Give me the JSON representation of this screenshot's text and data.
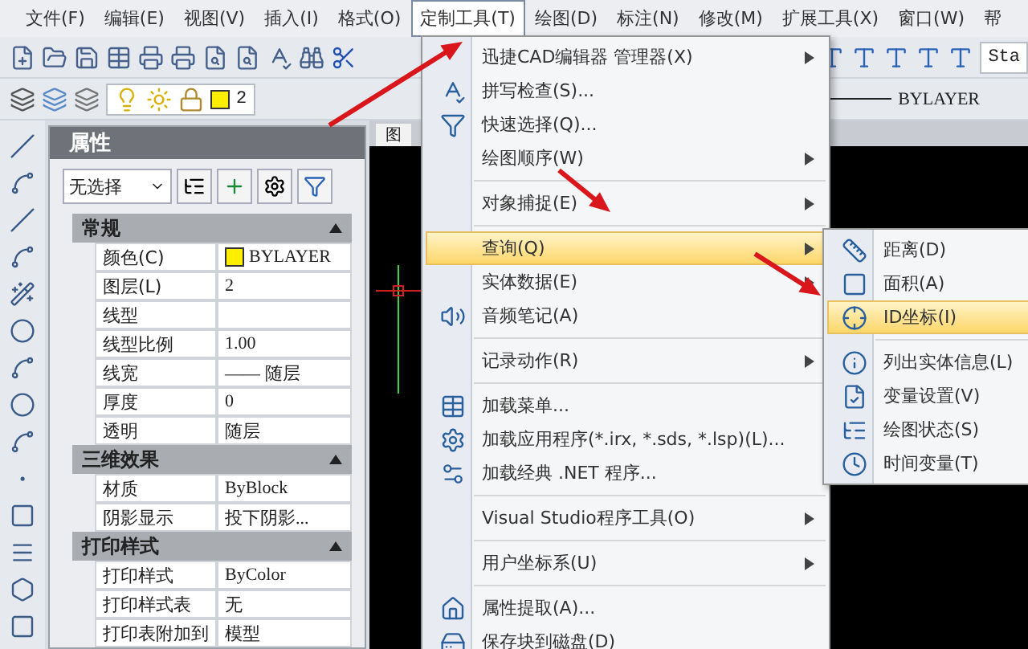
{
  "menubar": [
    {
      "label": "文件(F)",
      "selected": false
    },
    {
      "label": "编辑(E)",
      "selected": false
    },
    {
      "label": "视图(V)",
      "selected": false
    },
    {
      "label": "插入(I)",
      "selected": false
    },
    {
      "label": "格式(O)",
      "selected": false
    },
    {
      "label": "定制工具(T)",
      "selected": true
    },
    {
      "label": "绘图(D)",
      "selected": false
    },
    {
      "label": "标注(N)",
      "selected": false
    },
    {
      "label": "修改(M)",
      "selected": false
    },
    {
      "label": "扩展工具(X)",
      "selected": false
    },
    {
      "label": "窗口(W)",
      "selected": false
    },
    {
      "label": "帮",
      "selected": false
    }
  ],
  "toolbar": {
    "layer_value": "2",
    "linetype_value": "BYLAYER",
    "text_style_value": "Sta"
  },
  "properties": {
    "title": "属性",
    "selection": "无选择",
    "sections": [
      {
        "title": "常规",
        "expanded": true,
        "rows": [
          {
            "name": "颜色(C)",
            "value": "BYLAYER",
            "kind": "color"
          },
          {
            "name": "图层(L)",
            "value": "2",
            "kind": "text"
          },
          {
            "name": "线型",
            "value": "",
            "kind": "text"
          },
          {
            "name": "线型比例",
            "value": "1.00",
            "kind": "text"
          },
          {
            "name": "线宽",
            "value": "—— 随层",
            "kind": "text"
          },
          {
            "name": "厚度",
            "value": "0",
            "kind": "text"
          },
          {
            "name": "透明",
            "value": "随层",
            "kind": "text"
          }
        ]
      },
      {
        "title": "三维效果",
        "expanded": true,
        "rows": [
          {
            "name": "材质",
            "value": "ByBlock",
            "kind": "text"
          },
          {
            "name": "阴影显示",
            "value": "投下阴影...",
            "kind": "text"
          }
        ]
      },
      {
        "title": "打印样式",
        "expanded": true,
        "rows": [
          {
            "name": "打印样式",
            "value": "ByColor",
            "kind": "text"
          },
          {
            "name": "打印样式表",
            "value": "无",
            "kind": "text"
          },
          {
            "name": "打印表附加到",
            "value": "模型",
            "kind": "text"
          }
        ]
      }
    ]
  },
  "drawing_tab": "图",
  "menu": {
    "items": [
      {
        "kind": "command",
        "label": "迅捷CAD编辑器 管理器(X)",
        "submenu": true,
        "selected": false
      },
      {
        "kind": "command",
        "label": "拼写检查(S)...",
        "submenu": false,
        "selected": false
      },
      {
        "kind": "command",
        "label": "快速选择(Q)...",
        "submenu": false,
        "selected": false
      },
      {
        "kind": "command",
        "label": "绘图顺序(W)",
        "submenu": true,
        "selected": false
      },
      {
        "kind": "separator"
      },
      {
        "kind": "command",
        "label": "对象捕捉(E)",
        "submenu": true,
        "selected": false
      },
      {
        "kind": "separator"
      },
      {
        "kind": "command",
        "label": "查询(Q)",
        "submenu": true,
        "selected": true
      },
      {
        "kind": "command",
        "label": "实体数据(E)",
        "submenu": true,
        "selected": false
      },
      {
        "kind": "command",
        "label": "音频笔记(A)",
        "submenu": false,
        "selected": false
      },
      {
        "kind": "separator"
      },
      {
        "kind": "command",
        "label": "记录动作(R)",
        "submenu": true,
        "selected": false
      },
      {
        "kind": "separator"
      },
      {
        "kind": "command",
        "label": "加载菜单...",
        "submenu": false,
        "selected": false
      },
      {
        "kind": "command",
        "label": "加载应用程序(*.irx, *.sds, *.lsp)(L)...",
        "submenu": false,
        "selected": false
      },
      {
        "kind": "command",
        "label": "加载经典 .NET 程序...",
        "submenu": false,
        "selected": false
      },
      {
        "kind": "separator"
      },
      {
        "kind": "command",
        "label": "Visual Studio程序工具(O)",
        "submenu": true,
        "selected": false
      },
      {
        "kind": "separator"
      },
      {
        "kind": "command",
        "label": "用户坐标系(U)",
        "submenu": true,
        "selected": false
      },
      {
        "kind": "separator"
      },
      {
        "kind": "command",
        "label": "属性提取(A)...",
        "submenu": false,
        "selected": false
      },
      {
        "kind": "command",
        "label": "保存块到磁盘(D)",
        "submenu": false,
        "selected": false
      }
    ]
  },
  "submenu": {
    "items": [
      {
        "kind": "command",
        "label": "距离(D)",
        "selected": false
      },
      {
        "kind": "command",
        "label": "面积(A)",
        "selected": false
      },
      {
        "kind": "command",
        "label": "ID坐标(I)",
        "selected": true
      },
      {
        "kind": "separator"
      },
      {
        "kind": "command",
        "label": "列出实体信息(L)",
        "selected": false
      },
      {
        "kind": "command",
        "label": "变量设置(V)",
        "selected": false
      },
      {
        "kind": "command",
        "label": "绘图状态(S)",
        "selected": false
      },
      {
        "kind": "command",
        "label": "时间变量(T)",
        "selected": false
      }
    ]
  }
}
